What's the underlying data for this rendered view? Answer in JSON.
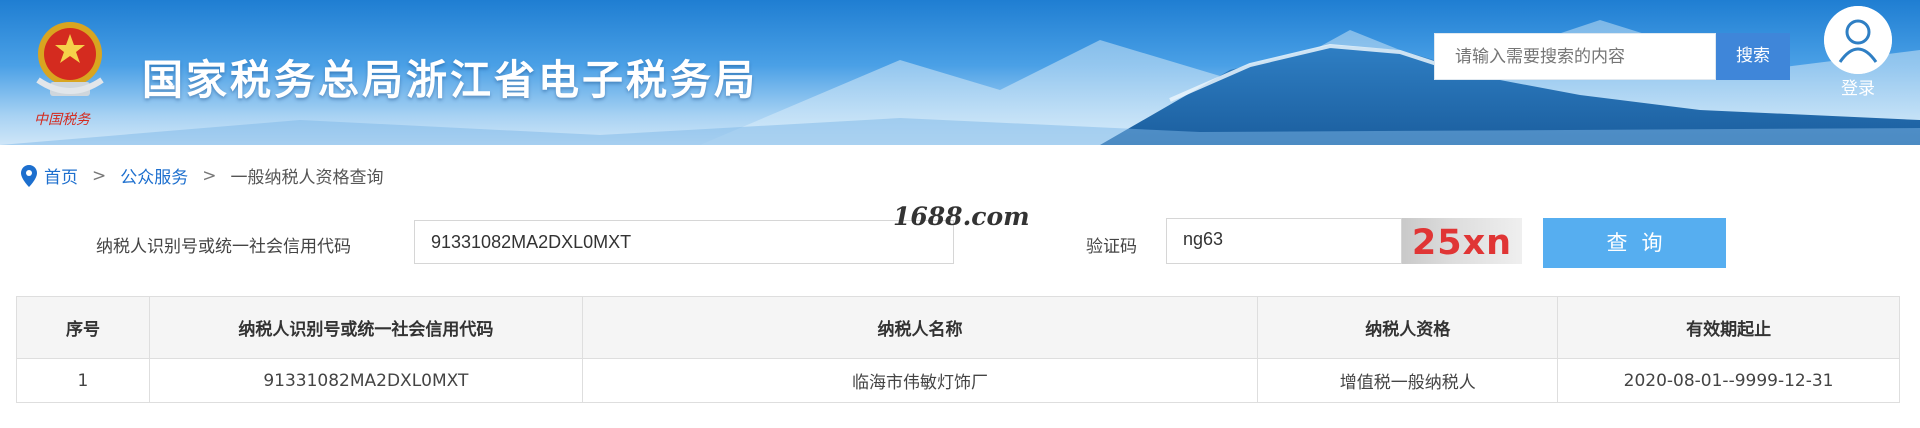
{
  "header": {
    "emblem_text": "中国税务",
    "site_title": "国家税务总局浙江省电子税务局",
    "search": {
      "placeholder": "请输入需要搜索的内容",
      "button_label": "搜索"
    },
    "login_label": "登录",
    "icons": [
      "tax-emblem-icon",
      "user-icon"
    ]
  },
  "breadcrumb": {
    "home": "首页",
    "separator": ">",
    "section": "公众服务",
    "current": "一般纳税人资格查询",
    "icon": "location-pin-icon"
  },
  "form": {
    "tin_label": "纳税人识别号或统一社会信用代码",
    "tin_value": "91331082MA2DXL0MXT",
    "watermark": "1688.com",
    "captcha_label": "验证码",
    "captcha_value": "ng63",
    "captcha_image_text": "25xn",
    "query_button": "查询"
  },
  "table": {
    "columns": [
      "序号",
      "纳税人识别号或统一社会信用代码",
      "纳税人名称",
      "纳税人资格",
      "有效期起止"
    ],
    "rows": [
      [
        "1",
        "91331082MA2DXL0MXT",
        "临海市伟敏灯饰厂",
        "增值税一般纳税人",
        "2020-08-01--9999-12-31"
      ]
    ]
  },
  "colors": {
    "accent_blue": "#3f86d9",
    "query_button": "#56aef0",
    "link_blue": "#1d6fce",
    "captcha_red": "#e03535"
  }
}
